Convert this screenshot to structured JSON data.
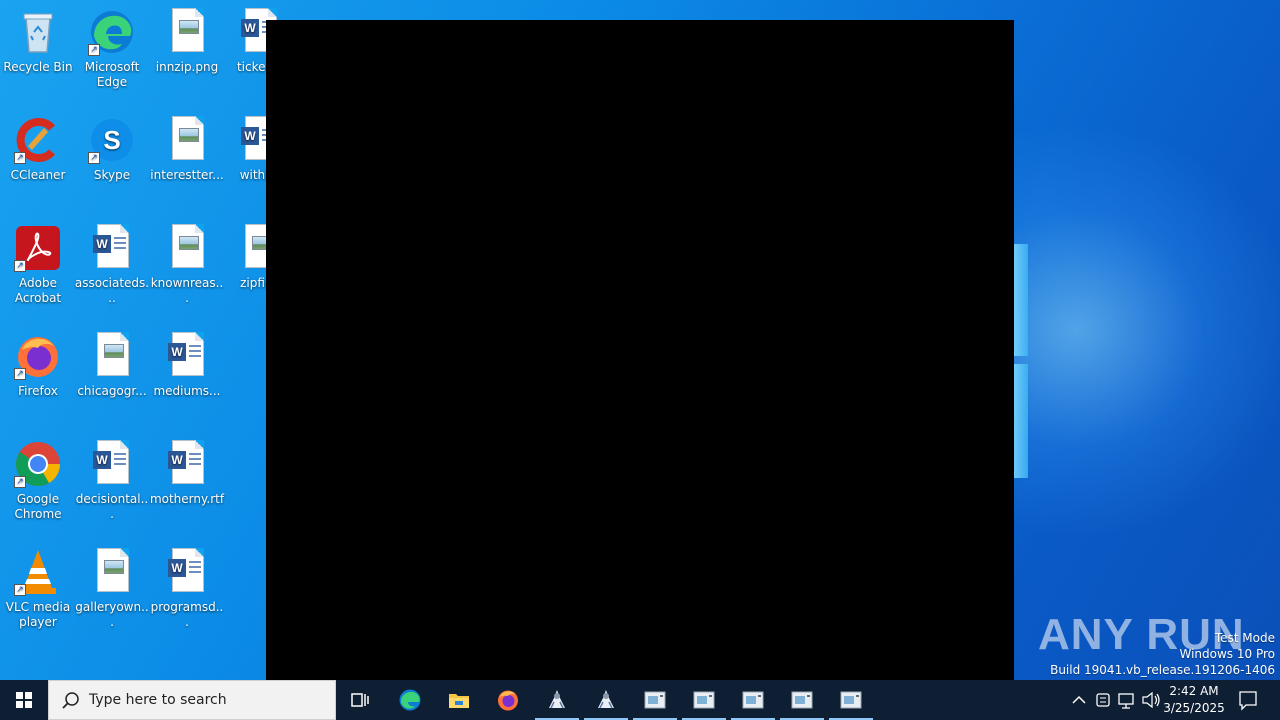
{
  "desktop": {
    "icons": [
      {
        "label": "Recycle Bin",
        "icon": "recycle-bin-icon"
      },
      {
        "label": "Microsoft Edge",
        "icon": "edge-icon"
      },
      {
        "label": "innzip.png",
        "icon": "image-file-icon"
      },
      {
        "label": "ticketsc",
        "icon": "word-doc-icon"
      },
      {
        "label": "CCleaner",
        "icon": "ccleaner-icon"
      },
      {
        "label": "Skype",
        "icon": "skype-icon"
      },
      {
        "label": "interestter...",
        "icon": "image-file-icon"
      },
      {
        "label": "withinf",
        "icon": "word-doc-icon"
      },
      {
        "label": "Adobe Acrobat",
        "icon": "acrobat-icon"
      },
      {
        "label": "associateds...",
        "icon": "word-doc-icon"
      },
      {
        "label": "knownreas...",
        "icon": "image-file-icon"
      },
      {
        "label": "zipfine",
        "icon": "image-file-icon"
      },
      {
        "label": "Firefox",
        "icon": "firefox-icon"
      },
      {
        "label": "chicagogr...",
        "icon": "image-file-icon"
      },
      {
        "label": "mediums...",
        "icon": "word-doc-icon"
      },
      {
        "label": "Google Chrome",
        "icon": "chrome-icon"
      },
      {
        "label": "decisiontal...",
        "icon": "word-doc-icon"
      },
      {
        "label": "motherny.rtf",
        "icon": "word-doc-icon"
      },
      {
        "label": "VLC media player",
        "icon": "vlc-icon"
      },
      {
        "label": "galleryown...",
        "icon": "image-file-icon"
      },
      {
        "label": "programsd...",
        "icon": "word-doc-icon"
      }
    ]
  },
  "watermark": {
    "brand": "ANY RUN",
    "line1": "Test Mode",
    "line2": "Windows 10 Pro",
    "line3": "Build 19041.vb_release.191206-1406"
  },
  "taskbar": {
    "search_placeholder": "Type here to search",
    "pinned": [
      "task-view-icon",
      "edge-icon",
      "file-explorer-icon",
      "firefox-icon",
      "app-icon",
      "app-icon",
      "window-icon",
      "window-icon",
      "window-icon",
      "window-icon",
      "window-icon"
    ],
    "clock": {
      "time": "2:42 AM",
      "date": "3/25/2025"
    }
  },
  "colors": {
    "taskbar": "#0f1f33",
    "desktop": "#0b8be6",
    "window": "#000000"
  }
}
